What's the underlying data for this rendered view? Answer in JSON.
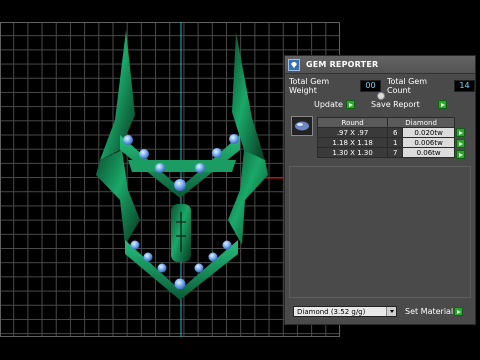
{
  "panel": {
    "title": "GEM REPORTER",
    "total_weight_label": "Total Gem Weight",
    "total_weight_value": "00",
    "total_count_label": "Total Gem Count",
    "total_count_value": "14",
    "update_label": "Update",
    "save_report_label": "Save Report",
    "table": {
      "headers": [
        "Round",
        "Diamond"
      ],
      "rows": [
        {
          "size": ".97 X .97",
          "count": "6",
          "weight": "0.020tw"
        },
        {
          "size": "1.18 X 1.18",
          "count": "1",
          "weight": "0.006tw"
        },
        {
          "size": "1.30 X 1.30",
          "count": "7",
          "weight": "0.06tw"
        }
      ]
    },
    "material_select_value": "Diamond    (3.52 g/g)",
    "set_material_label": "Set Material"
  },
  "colors": {
    "model_green": "#0f8a55",
    "gem_blue": "#6fa8f0",
    "axis_cyan": "#1fb8c9",
    "axis_red": "#c01818",
    "panel_bg": "#4a4a4a",
    "button_green": "#2fa52f"
  }
}
